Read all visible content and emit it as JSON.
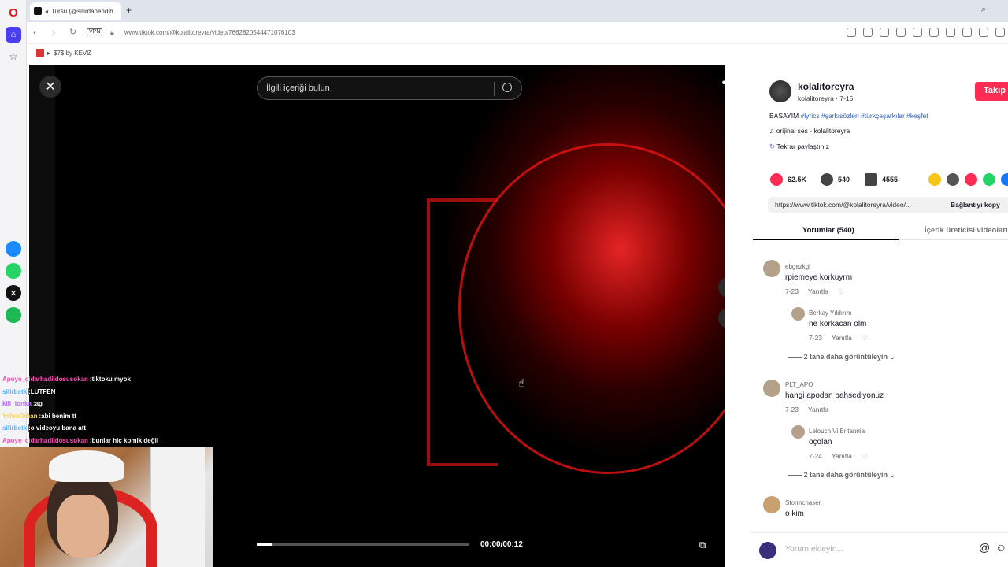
{
  "browser": {
    "tab_title": "Tursu (@sifirdanendib",
    "url": "www.tiktok.com/@kolalitoreyra/video/7662820544471076103",
    "vpn_label": "VPN",
    "bookmark_label": "$7$ by KEVØ"
  },
  "video": {
    "search_placeholder": "İlgili içeriği bulun",
    "time": "00:00/00:12",
    "progress": 0.07
  },
  "creator": {
    "name": "kolalitoreyra",
    "sub": "kolalitoreyra · 7-15",
    "follow_label": "Takip",
    "caption_prefix": "BASAYIM",
    "hashtags": "#lyrics #şarkısözleri #türkçeşarkılar #keşfet",
    "sound": "orijinal ses - kolalitoreyra",
    "repost": "Tekrar paylaştınız"
  },
  "stats": {
    "likes": "62.5K",
    "comments": "540",
    "saves": "4555"
  },
  "link": {
    "url": "https://www.tiktok.com/@kolalitoreyra/video/...",
    "copy_label": "Bağlantıyı kopy"
  },
  "tabs": {
    "comments": "Yorumlar (540)",
    "creator_videos": "İçerik üreticisi videoları"
  },
  "comments": [
    {
      "user": "ebgezkgl",
      "text": "rpiemeye korkuyrm",
      "date": "7-23",
      "reply": "Yanıtla"
    },
    {
      "user": "Berkay Yıldırım",
      "text": "ne korkacan olm",
      "date": "7-23",
      "reply": "Yanıtla"
    },
    {
      "user": "PLT_APO",
      "text": "hangi apodan bahsediyonuz",
      "date": "7-23",
      "reply": "Yanıtla"
    },
    {
      "user": "Lelouch Vi Britannia",
      "text": "oçolan",
      "date": "7-24",
      "reply": "Yanıtla"
    },
    {
      "user": "Stormchaser",
      "text": "o kim"
    }
  ],
  "more_replies": "2 tane daha görüntüleyin",
  "comment_placeholder": "Yorum ekleyin...",
  "chat": [
    {
      "user": "Apoye_cidarhadildosusokan",
      "msg": "tiktoku myok",
      "color": "#ff4fb8"
    },
    {
      "user": "sifirbetk",
      "msg": "LUTFEN",
      "color": "#5ab0ff"
    },
    {
      "user": "kili_tonka",
      "msg": "ag",
      "color": "#b66bff"
    },
    {
      "user": "YafesOrhan",
      "msg": "abi benim tt",
      "color": "#ffd24d"
    },
    {
      "user": "sifirbetk",
      "msg": "o videoyu bana att",
      "color": "#5ab0ff"
    },
    {
      "user": "Apoye_cidarhadildosusokan",
      "msg": "bunlar hiç komik değil",
      "color": "#ff4fb8"
    }
  ]
}
